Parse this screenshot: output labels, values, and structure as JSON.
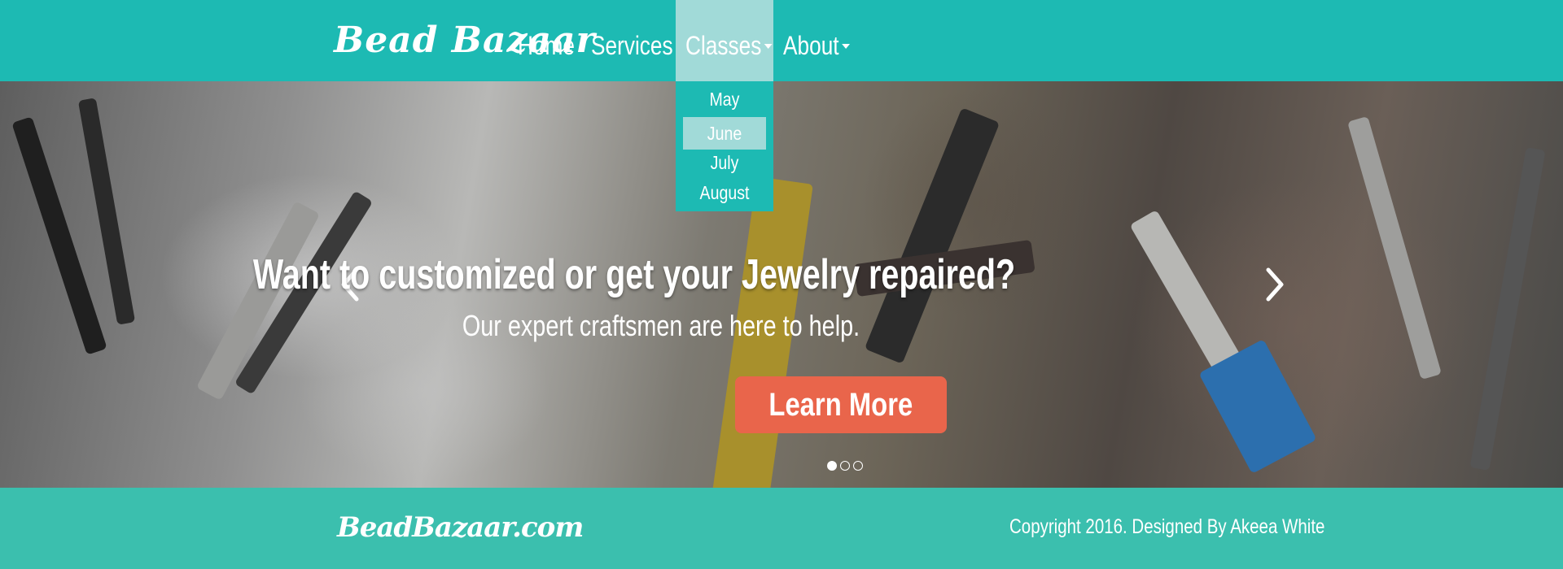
{
  "navbar": {
    "brand": "Bead Bazaar",
    "items": [
      {
        "label": "Home"
      },
      {
        "label": "Services"
      },
      {
        "label": "Classes"
      },
      {
        "label": "About"
      }
    ],
    "active_color": "#a1dad8",
    "bg_color": "#1dbab3"
  },
  "dropdown": {
    "items": [
      "May",
      "June",
      "July",
      "August"
    ],
    "highlighted": "June"
  },
  "hero": {
    "heading": "Want to customized or get your Jewelry repaired?",
    "subheading": "Our expert craftsmen are here to help.",
    "button_label": "Learn More",
    "button_color": "#e9654b",
    "slide_count": 3,
    "active_slide": 1
  },
  "footer": {
    "brand": "BeadBazaar.com",
    "copyright": "Copyright 2016. Designed By Akeea White",
    "bg_color": "#3bbfae"
  }
}
